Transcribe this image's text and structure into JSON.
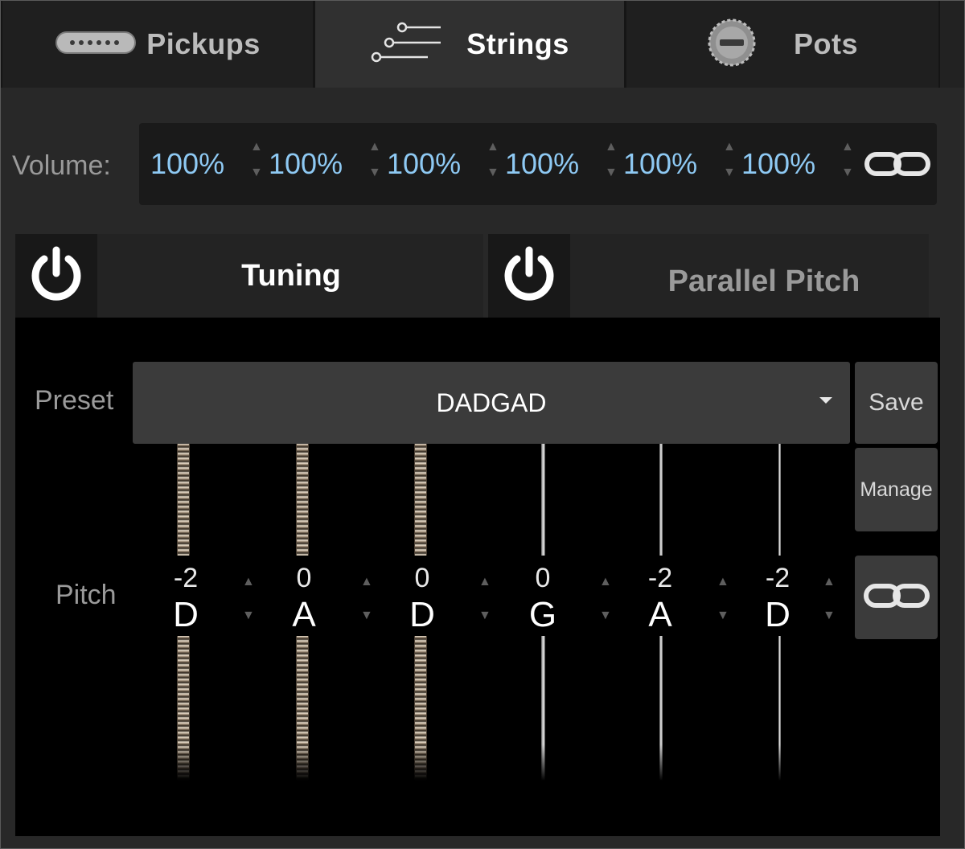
{
  "tabs": [
    {
      "label": "Pickups",
      "icon": "pickup-icon"
    },
    {
      "label": "Strings",
      "icon": "strings-icon",
      "active": true
    },
    {
      "label": "Pots",
      "icon": "knob-icon"
    }
  ],
  "volume": {
    "label": "Volume:",
    "values": [
      "100%",
      "100%",
      "100%",
      "100%",
      "100%",
      "100%"
    ],
    "link_icon": "link-icon"
  },
  "tuning_header": {
    "label": "Tuning",
    "power_icon": "power-icon",
    "enabled": true
  },
  "parallel_header": {
    "label": "Parallel Pitch",
    "power_icon": "power-icon",
    "enabled": true
  },
  "preset": {
    "label": "Preset",
    "value": "DADGAD",
    "save_label": "Save",
    "manage_label": "Manage"
  },
  "pitch": {
    "label": "Pitch",
    "strings": [
      {
        "offset": "-2",
        "note": "D"
      },
      {
        "offset": "0",
        "note": "A"
      },
      {
        "offset": "0",
        "note": "D"
      },
      {
        "offset": "0",
        "note": "G"
      },
      {
        "offset": "-2",
        "note": "A"
      },
      {
        "offset": "-2",
        "note": "D"
      }
    ],
    "link_icon": "link-icon"
  },
  "colors": {
    "accent_value": "#8ec9f3",
    "background": "#282828",
    "content_bg": "#000000"
  }
}
